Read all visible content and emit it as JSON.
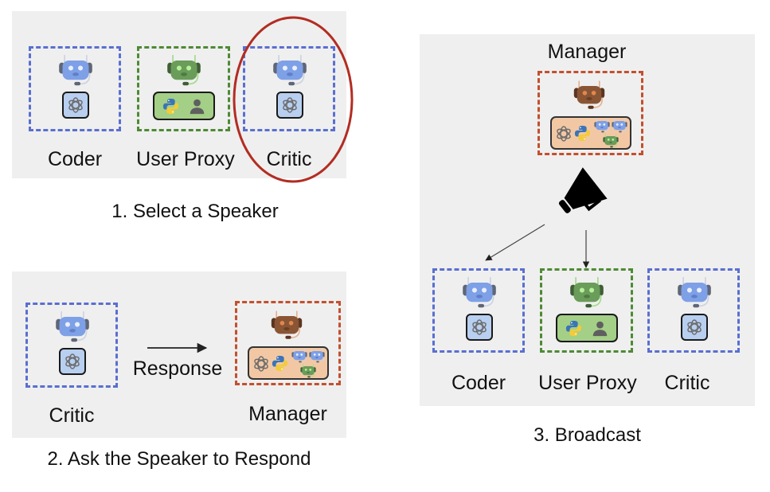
{
  "diagram": {
    "colors": {
      "panel_bg": "#efefef",
      "assistant_border": "#5a6fd0",
      "user_proxy_border": "#4e8a35",
      "manager_border": "#c2502e",
      "highlight_ellipse": "#b22d22",
      "blue_robot": "#7ea0e6",
      "green_robot": "#6a9c5a",
      "brown_robot": "#8a5534",
      "llm_tile": "#b8cff0",
      "user_proxy_tile": "#a4cf86",
      "manager_tile": "#f2c8a4"
    },
    "panels": [
      {
        "id": "select",
        "caption": "1. Select a Speaker",
        "agents": [
          {
            "name": "Coder",
            "role": "assistant",
            "tools": [
              "openai-icon"
            ]
          },
          {
            "name": "User Proxy",
            "role": "user_proxy",
            "tools": [
              "python-icon",
              "person-icon"
            ]
          },
          {
            "name": "Critic",
            "role": "assistant",
            "tools": [
              "openai-icon"
            ],
            "highlighted": true
          }
        ]
      },
      {
        "id": "respond",
        "caption": "2. Ask the Speaker to Respond",
        "from_agent": "Critic",
        "to_agent": "Manager",
        "edge_label": "Response"
      },
      {
        "id": "broadcast",
        "caption": "3. Broadcast",
        "manager": "Manager",
        "broadcast_icon": "megaphone-icon",
        "agents": [
          {
            "name": "Coder",
            "role": "assistant"
          },
          {
            "name": "User Proxy",
            "role": "user_proxy"
          },
          {
            "name": "Critic",
            "role": "assistant"
          }
        ]
      }
    ]
  }
}
